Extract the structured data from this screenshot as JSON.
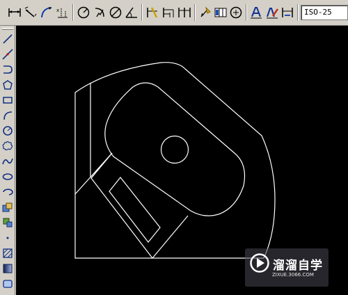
{
  "top_toolbar": {
    "buttons": [
      {
        "icon": "linear-dimension-icon"
      },
      {
        "icon": "aligned-dimension-icon"
      },
      {
        "icon": "arc-length-icon"
      },
      {
        "icon": "ordinate-dimension-icon"
      },
      {
        "icon": "radius-dimension-icon"
      },
      {
        "icon": "jogged-dimension-icon"
      },
      {
        "icon": "diameter-dimension-icon"
      },
      {
        "icon": "angular-dimension-icon"
      },
      {
        "icon": "quick-dimension-icon"
      },
      {
        "icon": "baseline-dimension-icon"
      },
      {
        "icon": "continue-dimension-icon"
      },
      {
        "icon": "quick-leader-icon"
      },
      {
        "icon": "tolerance-icon"
      },
      {
        "icon": "center-mark-icon"
      },
      {
        "icon": "dimension-edit-icon"
      },
      {
        "icon": "dimension-text-edit-icon"
      },
      {
        "icon": "dimension-update-icon"
      }
    ],
    "dim_style_value": "ISO-25"
  },
  "left_toolbar": {
    "buttons": [
      {
        "icon": "line-icon"
      },
      {
        "icon": "construction-line-icon"
      },
      {
        "icon": "polyline-icon"
      },
      {
        "icon": "polygon-icon"
      },
      {
        "icon": "rectangle-icon"
      },
      {
        "icon": "arc-icon"
      },
      {
        "icon": "circle-icon"
      },
      {
        "icon": "revision-cloud-icon"
      },
      {
        "icon": "spline-icon"
      },
      {
        "icon": "ellipse-icon"
      },
      {
        "icon": "ellipse-arc-icon"
      },
      {
        "icon": "insert-block-icon"
      },
      {
        "icon": "make-block-icon"
      },
      {
        "icon": "point-icon"
      },
      {
        "icon": "hatch-icon"
      },
      {
        "icon": "gradient-icon"
      },
      {
        "icon": "region-icon"
      }
    ]
  },
  "watermark": {
    "text_cn": "溜溜自学",
    "url": "ZIXUE.3066.COM"
  }
}
